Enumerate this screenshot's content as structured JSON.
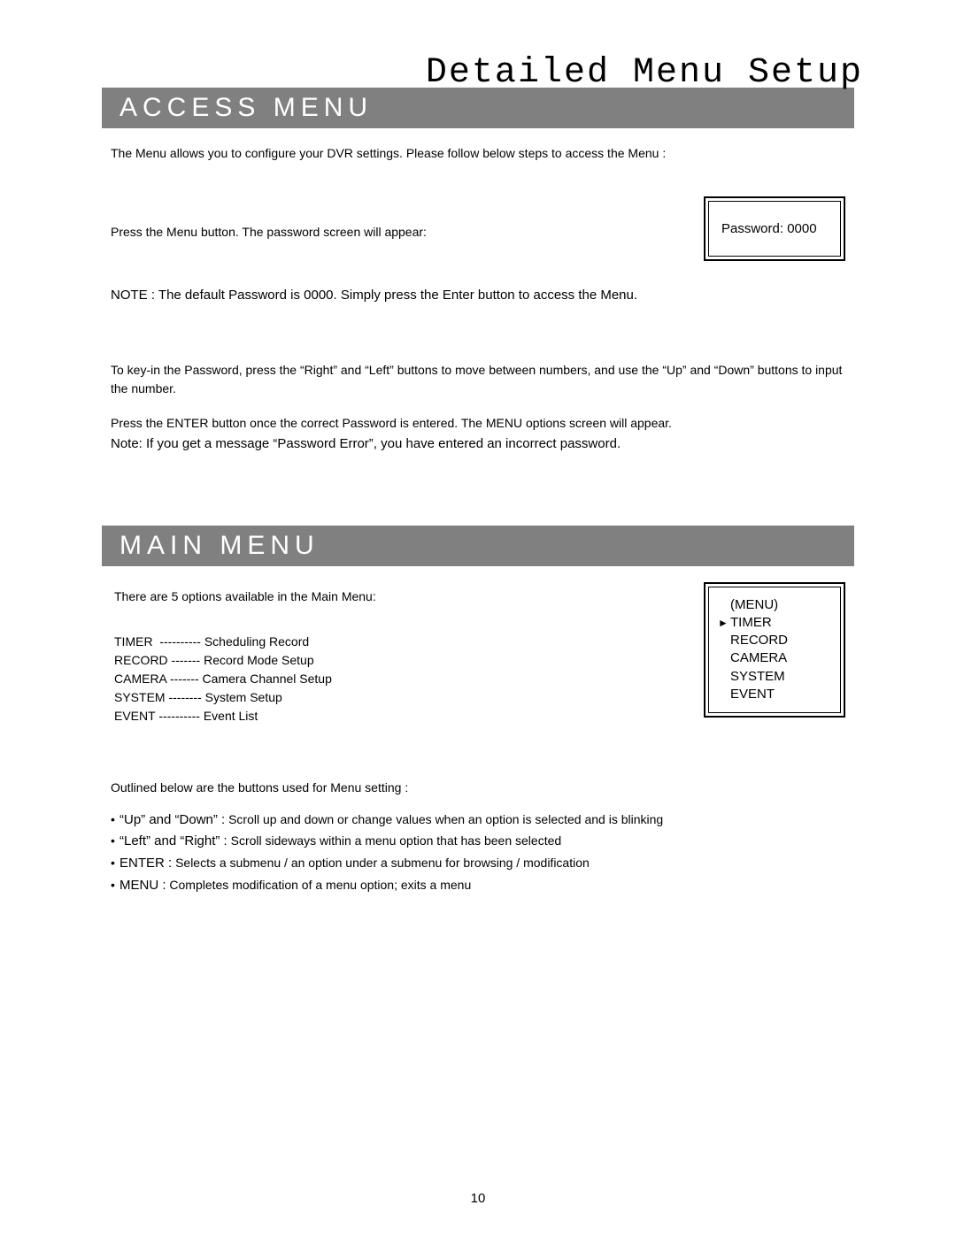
{
  "page": {
    "chapter_title": "Detailed Menu Setup",
    "page_number": "10"
  },
  "access": {
    "heading": "ACCESS MENU",
    "intro": "The Menu allows you to configure your DVR settings. Please follow below steps to access the Menu :",
    "press_menu": "Press the Menu button. The password screen will appear:",
    "password_box": "Password: 0000",
    "note_label": "NOTE :",
    "note_text": " The default Password is 0000. Simply press the Enter button to access the Menu.",
    "keyin": "To key-in the Password, press the “Right” and “Left” buttons to move between numbers, and use the “Up” and “Down” buttons to input the number.",
    "press_enter": "Press the ENTER button once the correct Password is entered. The MENU options screen will appear.",
    "error_note": "Note: If you get a message “Password Error”, you have entered an incorrect password."
  },
  "main": {
    "heading": "MAIN MENU",
    "intro": "There are 5 options available in the Main Menu:",
    "defs": [
      {
        "name": "TIMER  ----------",
        "desc": " Scheduling Record"
      },
      {
        "name": "RECORD -------",
        "desc": " Record Mode Setup"
      },
      {
        "name": "CAMERA -------",
        "desc": " Camera Channel Setup"
      },
      {
        "name": "SYSTEM --------",
        "desc": " System Setup"
      },
      {
        "name": "EVENT ----------",
        "desc": " Event List"
      }
    ],
    "menu_box": {
      "title": "(MENU)",
      "items": [
        "TIMER",
        "RECORD",
        "CAMERA",
        "SYSTEM",
        "EVENT"
      ],
      "pointer": "►"
    },
    "outlined": "Outlined below are the buttons used for Menu setting :",
    "bullets": [
      {
        "label": "“Up” and “Down” :",
        "text": " Scroll up and down or change values when an option is selected and is blinking"
      },
      {
        "label": "“Left” and “Right” :",
        "text": " Scroll sideways within a menu option that has been selected"
      },
      {
        "label": "ENTER :",
        "text": " Selects a submenu / an option under a submenu for browsing / modification"
      },
      {
        "label": "MENU :",
        "text": " Completes modification of a menu option; exits a menu"
      }
    ]
  }
}
